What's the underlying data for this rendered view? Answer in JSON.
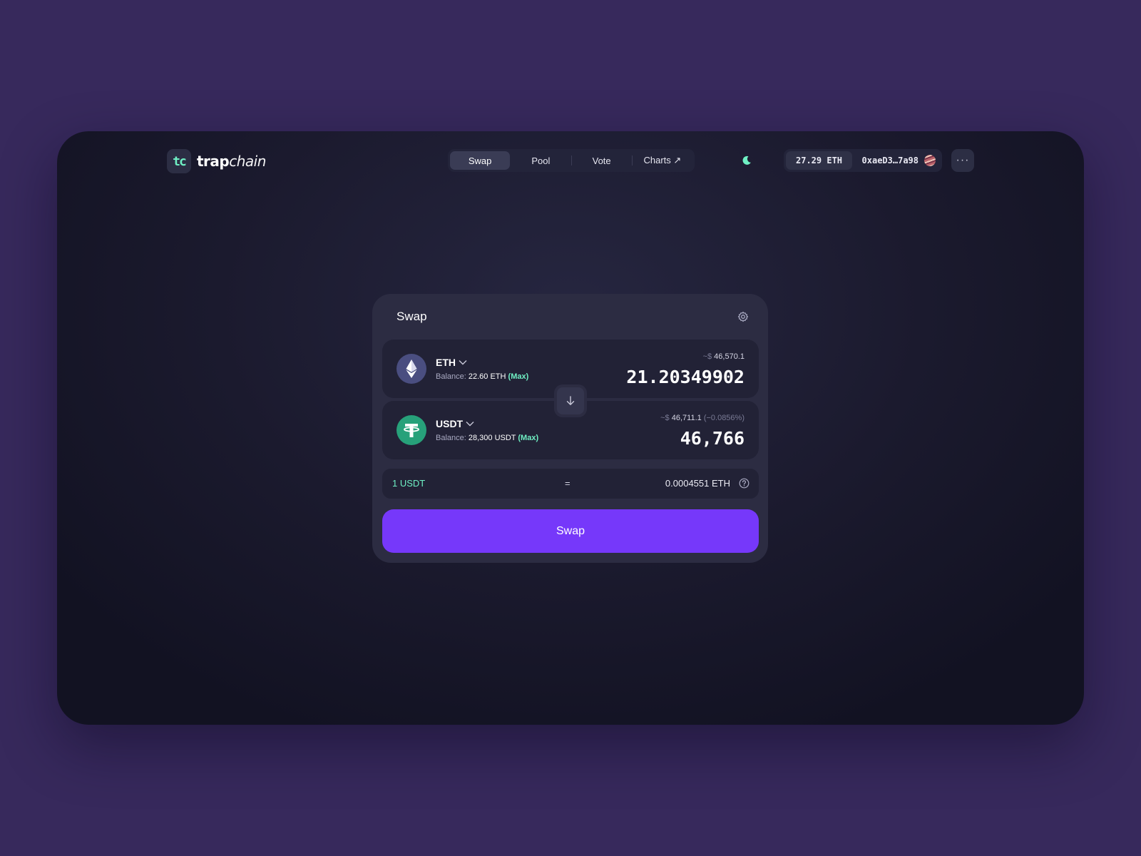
{
  "brand": {
    "mark": "tc",
    "name_part1": "trap",
    "name_part2": "chain"
  },
  "nav": {
    "tabs": [
      {
        "label": "Swap",
        "active": true
      },
      {
        "label": "Pool",
        "active": false
      },
      {
        "label": "Vote",
        "active": false
      },
      {
        "label": "Charts ↗",
        "active": false
      }
    ]
  },
  "header": {
    "theme_icon": "moon-icon",
    "wallet_balance": "27.29 ETH",
    "wallet_address": "0xaeD3…7a98",
    "more_icon": "more-icon",
    "more_glyph": "···"
  },
  "swap": {
    "title": "Swap",
    "settings_icon": "gear-icon",
    "from": {
      "symbol": "ETH",
      "balance_label": "Balance:",
      "balance_value": "22.60 ETH",
      "max_label": "(Max)",
      "usd_prefix": "~$",
      "usd_value": "46,570.1",
      "usd_change": "",
      "amount": "21.20349902"
    },
    "to": {
      "symbol": "USDT",
      "balance_label": "Balance:",
      "balance_value": "28,300 USDT",
      "max_label": "(Max)",
      "usd_prefix": "~$",
      "usd_value": "46,711.1",
      "usd_change": "(−0.0856%)",
      "amount": "46,766"
    },
    "rate": {
      "from": "1 USDT",
      "equals": "=",
      "to": "0.0004551 ETH"
    },
    "button_label": "Swap"
  },
  "colors": {
    "background": "#37295c",
    "accent": "#7638fa",
    "highlight": "#6ff0c4",
    "usdt": "#27a17a",
    "eth": "#4a4e80"
  }
}
